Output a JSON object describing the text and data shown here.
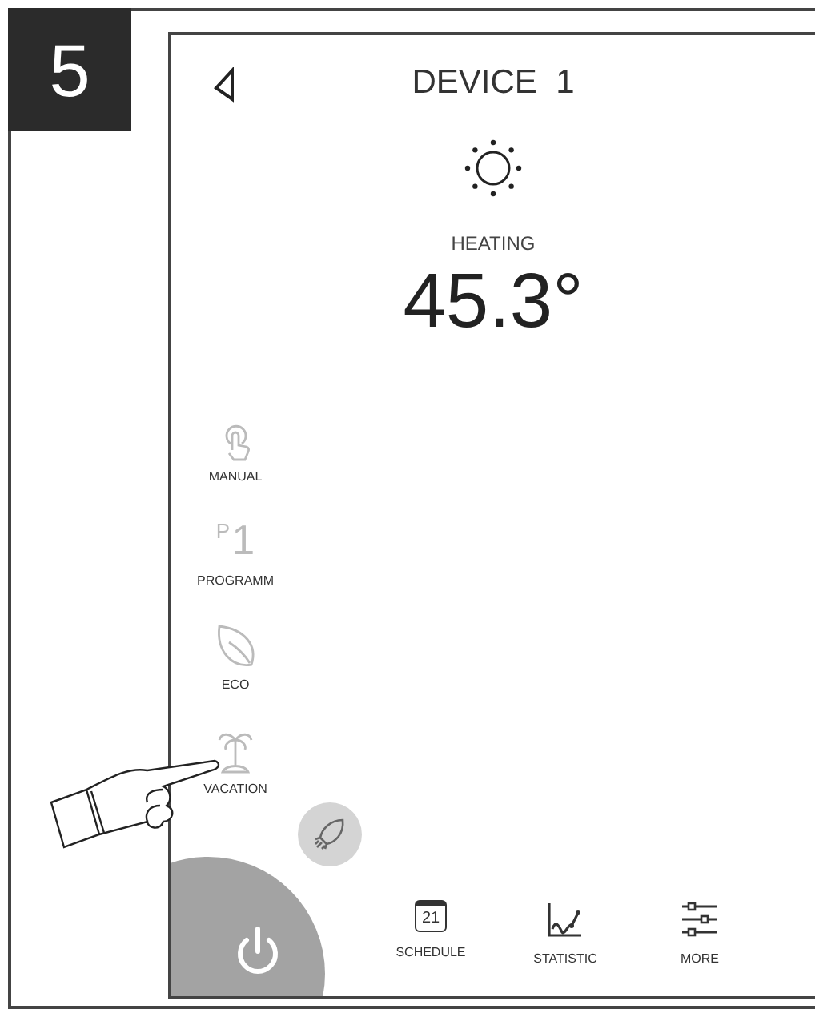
{
  "step": "5",
  "header": {
    "title": "DEVICE  1"
  },
  "status": {
    "label": "HEATING",
    "temperature": "45.3°"
  },
  "modes": [
    {
      "kind": "manual",
      "label": "MANUAL"
    },
    {
      "kind": "program",
      "label": "PROGRAMM",
      "icon_letter": "P",
      "icon_digit": "1"
    },
    {
      "kind": "eco",
      "label": "ECO"
    },
    {
      "kind": "vacation",
      "label": "VACATION"
    }
  ],
  "nav": [
    {
      "kind": "schedule",
      "label": "SCHEDULE",
      "icon_text": "21"
    },
    {
      "kind": "statistic",
      "label": "STATISTIC"
    },
    {
      "kind": "more",
      "label": "MORE"
    }
  ]
}
